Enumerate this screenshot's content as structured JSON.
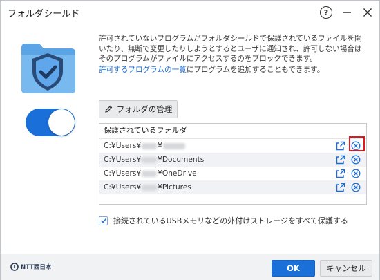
{
  "window": {
    "title": "フォルダシールド",
    "help_glyph": "?"
  },
  "description": {
    "main": "許可されていないプログラムがフォルダシールドで保護されているファイルを開いたり、無断で変更したりしようとするとユーザに通知され、許可しない場合はそのプログラムがファイルにアクセスするのをブロックできます。",
    "link_text": "許可するプログラムの一覧",
    "link_suffix": "にプログラムを追加することもできます。"
  },
  "toggle": {
    "state": "on"
  },
  "manage_button": {
    "label": "フォルダの管理",
    "icon": "pencil-icon"
  },
  "folder_list": {
    "header": "保護されているフォルダ",
    "rows": [
      {
        "prefix": "C:¥Users¥",
        "suffix": "¥",
        "tail": ""
      },
      {
        "prefix": "C:¥Users¥",
        "suffix": "¥Documents",
        "tail": ""
      },
      {
        "prefix": "C:¥Users¥",
        "suffix": "¥OneDrive",
        "tail": ""
      },
      {
        "prefix": "C:¥Users¥",
        "suffix": "¥Pictures",
        "tail": ""
      }
    ]
  },
  "usb_option": {
    "label": "接続されているUSBメモリなどの外付けストレージをすべて保護する",
    "checked": true
  },
  "footer": {
    "brand": "NTT西日本",
    "ok_label": "OK",
    "cancel_label": "キャンセル"
  },
  "colors": {
    "accent": "#1b6fd8",
    "highlight": "#e2161d",
    "link": "#1a6ed6"
  }
}
